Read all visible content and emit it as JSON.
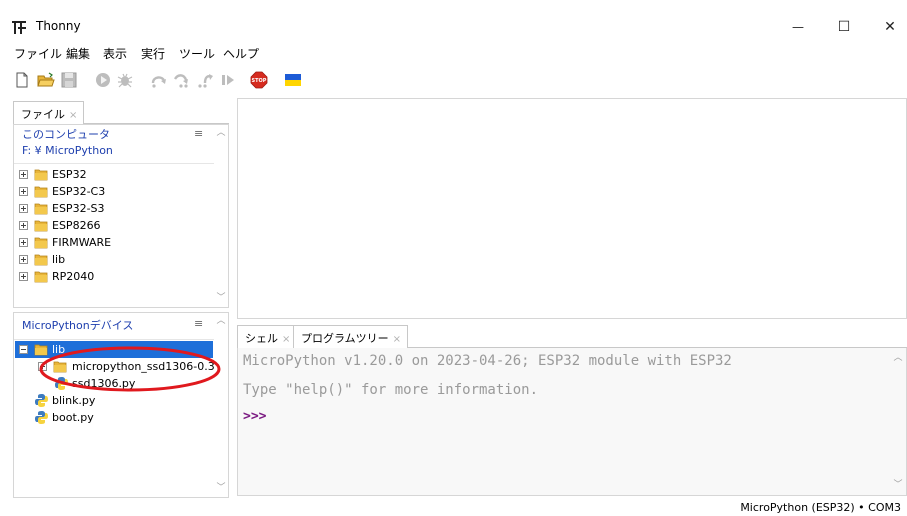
{
  "window": {
    "title": "Thonny",
    "minimize_glyph": "—",
    "maximize_glyph": "☐",
    "close_glyph": "✕"
  },
  "menu": [
    "ファイル",
    "編集",
    "表示",
    "実行",
    "ツール",
    "ヘルプ"
  ],
  "toolbar": {
    "icons": [
      "new-file-icon",
      "open-folder-icon",
      "save-icon",
      "run-icon",
      "debug-icon",
      "step-over-icon",
      "step-into-icon",
      "step-out-icon",
      "resume-icon",
      "stop-icon",
      "ukraine-flag-icon"
    ],
    "stop_label": "STOP",
    "colors": {
      "stop": "#d62b1f",
      "flag_blue": "#1d5bd6",
      "flag_yellow": "#ffd500",
      "disabled": "#b9b9b9"
    }
  },
  "left_tab": {
    "label": "ファイル",
    "close": "×"
  },
  "local_panel": {
    "title": "このコンピュータ",
    "path": "F: ¥ MicroPython",
    "menu_glyph": "≡",
    "items": [
      {
        "label": "ESP32"
      },
      {
        "label": "ESP32-C3"
      },
      {
        "label": "ESP32-S3"
      },
      {
        "label": "ESP8266"
      },
      {
        "label": "FIRMWARE"
      },
      {
        "label": "lib"
      },
      {
        "label": "RP2040"
      }
    ]
  },
  "device_panel": {
    "title": "MicroPythonデバイス",
    "menu_glyph": "≡",
    "root_folder": "lib",
    "subfolder": "micropython_ssd1306-0.3",
    "subfile": "ssd1306.py",
    "files": [
      "blink.py",
      "boot.py"
    ]
  },
  "shell_tabs": [
    {
      "label": "シェル",
      "close": "×"
    },
    {
      "label": "プログラムツリー",
      "close": "×"
    }
  ],
  "shell": {
    "line1": "MicroPython v1.20.0 on 2023-04-26; ESP32 module with ESP32",
    "line2": "Type \"help()\" for more information.",
    "prompt": ">>>"
  },
  "status": {
    "text": "MicroPython (ESP32)  •  COM3"
  },
  "colors": {
    "accent": "#1e3fae",
    "selection": "#1e6fd9",
    "annotation": "#e0191e",
    "prompt": "#7b1b82"
  }
}
